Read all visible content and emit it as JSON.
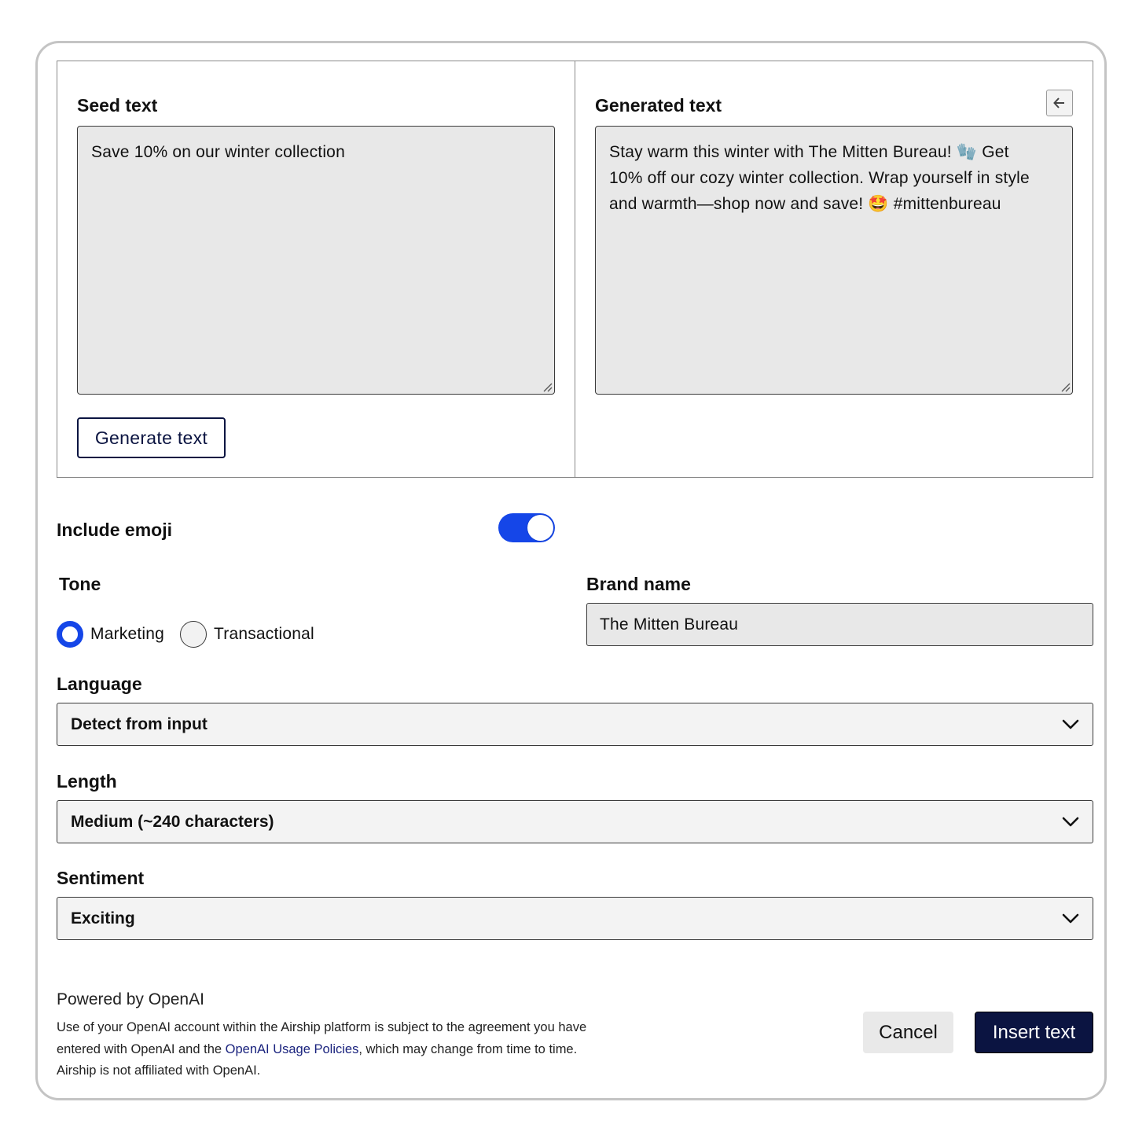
{
  "seed": {
    "title": "Seed text",
    "value": "Save 10% on our winter collection",
    "generate_label": "Generate text"
  },
  "generated": {
    "title": "Generated text",
    "line1": "Stay warm this winter with The Mitten Bureau! 🧤 Get",
    "line2": "10% off our cozy winter collection. Wrap yourself in style",
    "line3": "and warmth—shop now and save! 🤩 #mittenbureau",
    "back_icon": "arrow-left-icon"
  },
  "emoji": {
    "label": "Include emoji",
    "enabled": true,
    "accent": "#1546e8"
  },
  "tone": {
    "label": "Tone",
    "options": [
      {
        "label": "Marketing",
        "selected": true
      },
      {
        "label": "Transactional",
        "selected": false
      }
    ]
  },
  "brand": {
    "label": "Brand name",
    "value": "The Mitten Bureau"
  },
  "language": {
    "label": "Language",
    "value": "Detect from input"
  },
  "length": {
    "label": "Length",
    "value": "Medium (~240 characters)"
  },
  "sentiment": {
    "label": "Sentiment",
    "value": "Exciting"
  },
  "footer": {
    "powered": "Powered by OpenAI",
    "legal_before": "Use of your OpenAI account within the Airship platform is subject to the agreement you have entered with OpenAI and the ",
    "legal_link": "OpenAI Usage Policies",
    "legal_after": ", which may change from time to time. Airship is not affiliated with OpenAI.",
    "cancel_label": "Cancel",
    "insert_label": "Insert text",
    "primary_color": "#0b1441"
  }
}
